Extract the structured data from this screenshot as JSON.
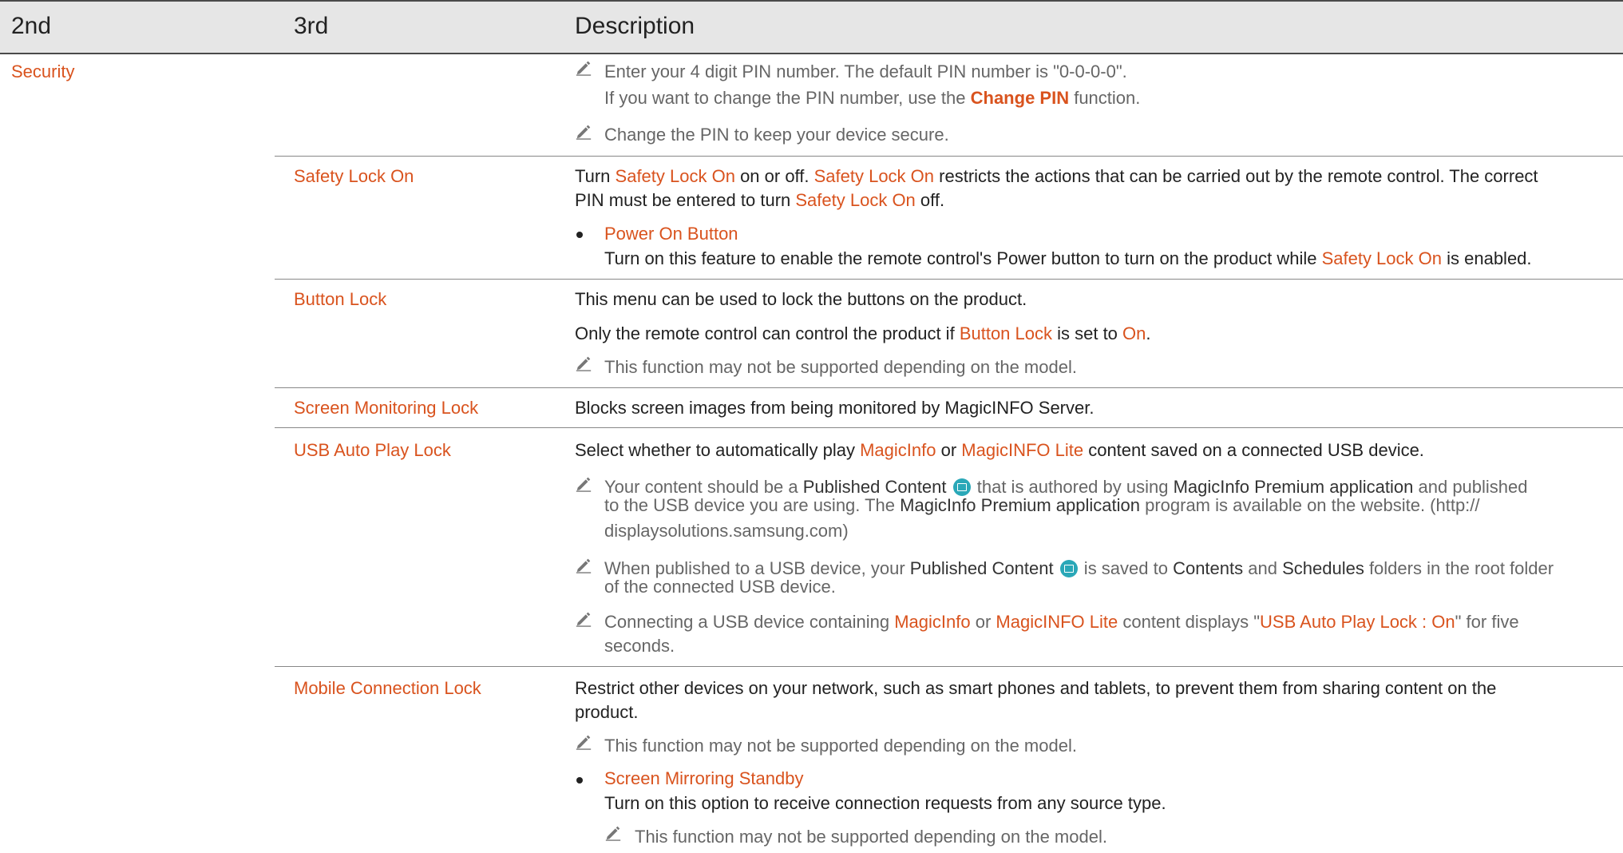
{
  "header": {
    "col_2nd": "2nd",
    "col_3rd": "3rd",
    "col_desc": "Description"
  },
  "security": {
    "label": "Security",
    "pin_note_1a": "Enter your 4 digit PIN number. The default PIN number is \"0-0-0-0\".",
    "pin_note_1b_pre": "If you want to change the PIN number, use the ",
    "pin_note_1b_link": "Change PIN",
    "pin_note_1b_post": " function.",
    "pin_note_2": "Change the PIN to keep your device secure."
  },
  "safety_lock": {
    "label": "Safety Lock On",
    "d1_pre": "Turn ",
    "d1_link1": "Safety Lock On",
    "d1_mid": " on or off. ",
    "d1_link2": "Safety Lock On",
    "d1_post": " restricts the actions that can be carried out by the remote control. The correct",
    "d2_pre": "PIN must be entered to turn ",
    "d2_link": "Safety Lock On",
    "d2_post": " off.",
    "bullet_title": "Power On Button",
    "bullet_desc_pre": "Turn on this feature to enable the remote control's Power button to turn on the product while ",
    "bullet_desc_link": "Safety Lock On",
    "bullet_desc_post": " is enabled."
  },
  "button_lock": {
    "label": "Button Lock",
    "d1": "This menu can be used to lock the buttons on the product.",
    "d2_pre": "Only the remote control can control the product if ",
    "d2_link1": "Button Lock",
    "d2_mid": " is set to ",
    "d2_link2": "On",
    "d2_post": ".",
    "note": "This function may not be supported depending on the model."
  },
  "screen_monitoring": {
    "label": "Screen Monitoring Lock",
    "d1": "Blocks screen images from being monitored by MagicINFO Server."
  },
  "usb_lock": {
    "label": "USB Auto Play Lock",
    "d1_pre": "Select whether to automatically play ",
    "d1_link1": "MagicInfo",
    "d1_mid": " or ",
    "d1_link2": "MagicINFO Lite",
    "d1_post": " content saved on a connected USB device.",
    "n1_a_pre": "Your content should be a ",
    "n1_a_b1": "Published Content",
    "n1_a_mid": " that is authored by using ",
    "n1_a_b2": "MagicInfo Premium application",
    "n1_a_post": " and published",
    "n1_b_pre": "to the USB device you are using. The ",
    "n1_b_b": "MagicInfo Premium application",
    "n1_b_post": " program is available on the website. (http://",
    "n1_c": "displaysolutions.samsung.com)",
    "n2_a_pre": "When published to a USB device, your ",
    "n2_a_b1": "Published Content",
    "n2_a_mid": " is saved to ",
    "n2_a_b2": "Contents",
    "n2_a_and": " and ",
    "n2_a_b3": "Schedules",
    "n2_a_post": " folders in the root folder",
    "n2_b": "of the connected USB device.",
    "n3_a_pre": "Connecting a USB device containing ",
    "n3_a_link1": "MagicInfo",
    "n3_a_mid": " or ",
    "n3_a_link2": "MagicINFO Lite",
    "n3_a_mid2": " content displays \"",
    "n3_a_link3": "USB Auto Play Lock : On",
    "n3_a_post": "\" for five",
    "n3_b": "seconds."
  },
  "mobile_lock": {
    "label": "Mobile Connection Lock",
    "d1": "Restrict other devices on your network, such as smart phones and tablets, to prevent them from sharing content on the",
    "d2": "product.",
    "note": "This function may not be supported depending on the model.",
    "bullet_title": "Screen Mirroring Standby",
    "bullet_desc": "Turn on this option to receive connection requests from any source type.",
    "sub_note": "This function may not be supported depending on the model."
  },
  "icons": {
    "note": "pencil-icon",
    "published": "published-content-icon"
  },
  "colors": {
    "accent": "#d9531e",
    "note_text": "#666666",
    "header_bg": "#e6e6e6"
  }
}
